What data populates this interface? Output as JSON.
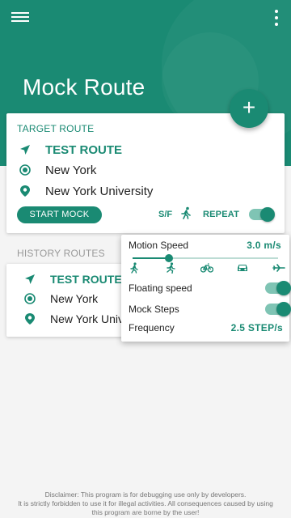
{
  "header": {
    "title": "Mock Route",
    "menu_icon": "hamburger-menu-icon",
    "more_icon": "more-vert-icon",
    "color": "#1a8a73"
  },
  "fab": {
    "label": "+"
  },
  "target_card": {
    "title": "TARGET ROUTE",
    "route_name": "TEST ROUTE",
    "start": "New York",
    "destination": "New York University",
    "start_button": "START MOCK",
    "sf_label": "S/F",
    "repeat_label": "REPEAT",
    "repeat_enabled": true
  },
  "history": {
    "label": "HISTORY ROUTES",
    "route_name": "TEST ROUTE",
    "start": "New York",
    "destination": "New York University"
  },
  "popup": {
    "motion_speed_label": "Motion Speed",
    "motion_speed_value": "3.0 m/s",
    "speed_level": 0.25,
    "modes": [
      "walk-icon",
      "run-icon",
      "bike-icon",
      "car-icon",
      "plane-icon"
    ],
    "floating_speed_label": "Floating speed",
    "floating_speed_enabled": true,
    "mock_steps_label": "Mock Steps",
    "mock_steps_enabled": true,
    "frequency_label": "Frequency",
    "frequency_value": "2.5 STEP/s"
  },
  "disclaimer": {
    "line1": "Disclaimer: This program is for debugging use only by developers.",
    "line2": "It is strictly forbidden to use it for illegal activities. All consequences caused by using",
    "line3": "this program are borne by the user!"
  }
}
